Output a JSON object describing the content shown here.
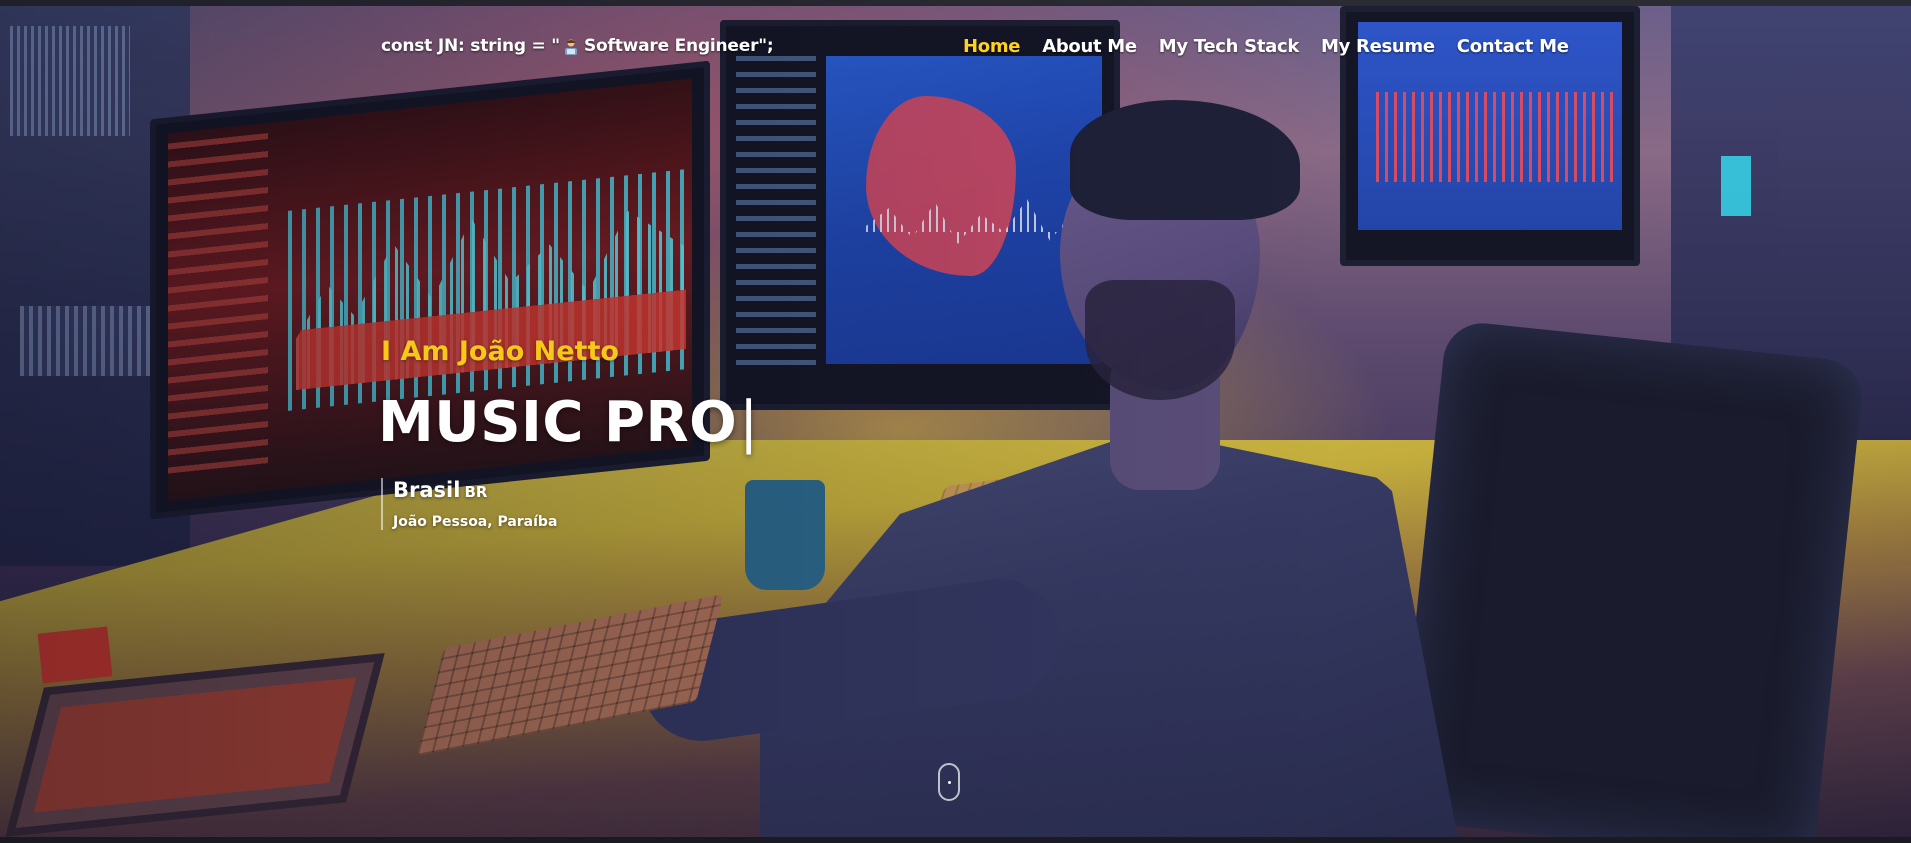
{
  "nav": {
    "brand_prefix": "const JN: string = \"",
    "brand_icon": "technologist-icon",
    "brand_suffix": " Software Engineer\";",
    "links": [
      {
        "label": "Home",
        "active": true
      },
      {
        "label": "About Me",
        "active": false
      },
      {
        "label": "My Tech Stack",
        "active": false
      },
      {
        "label": "My Resume",
        "active": false
      },
      {
        "label": "Contact Me",
        "active": false
      }
    ]
  },
  "hero": {
    "greeting": "I Am João Netto",
    "typed_text": "MUSIC PRO",
    "cursor": "|",
    "country": "Brasil",
    "country_code": "BR",
    "city": "João Pessoa, Paraíba",
    "scroll_icon": "mouse-scroll-icon"
  },
  "colors": {
    "accent": "#ffd21f",
    "greeting": "#f7c81a",
    "text": "#ffffff"
  }
}
